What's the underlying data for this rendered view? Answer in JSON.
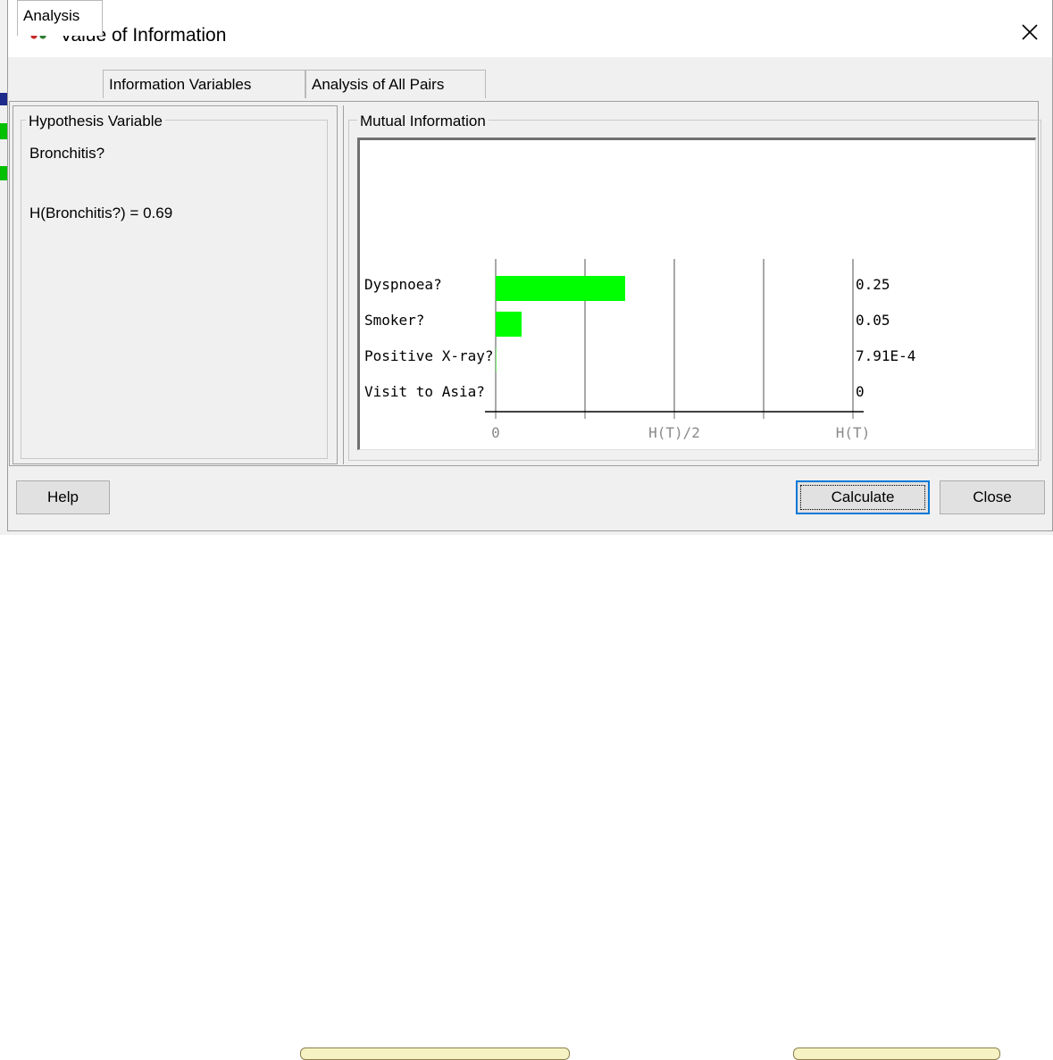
{
  "window": {
    "title": "Value of Information",
    "icon": "network-nodes-icon",
    "close_icon": "close-icon"
  },
  "tabs": [
    {
      "label": "Analysis",
      "active": true
    },
    {
      "label": "Information Variables",
      "active": false
    },
    {
      "label": "Analysis of All Pairs",
      "active": false
    }
  ],
  "hypothesis": {
    "legend": "Hypothesis Variable",
    "variable": "Bronchitis?",
    "entropy": "H(Bronchitis?) = 0.69"
  },
  "mutual_information": {
    "legend": "Mutual Information"
  },
  "chart_data": {
    "type": "bar",
    "orientation": "horizontal",
    "categories": [
      "Dyspnoea?",
      "Smoker?",
      "Positive X-ray?",
      "Visit to Asia?"
    ],
    "values": [
      0.25,
      0.05,
      0.000791,
      0
    ],
    "value_labels": [
      "0.25",
      "0.05",
      "7.91E-4",
      "0"
    ],
    "x_ticks": [
      "0",
      "H(T)/2",
      "H(T)"
    ],
    "xlim": [
      0,
      0.69
    ],
    "grid": true,
    "bar_color": "#00ff00"
  },
  "buttons": {
    "help": "Help",
    "calculate": "Calculate",
    "close": "Close"
  },
  "colors": {
    "bar": "#00ff00",
    "focus": "#0078d7"
  }
}
